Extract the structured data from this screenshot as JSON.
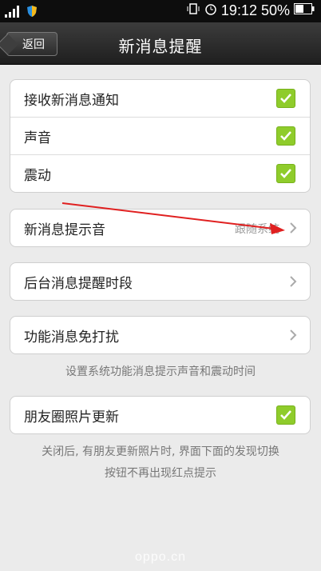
{
  "status_bar": {
    "signal_icon": "signal-icon",
    "shield_icon": "shield-icon",
    "time": "19:12",
    "battery_percent": "50%"
  },
  "header": {
    "back_label": "返回",
    "title": "新消息提醒"
  },
  "group_notifications": {
    "items": [
      {
        "label": "接收新消息通知",
        "checked": true
      },
      {
        "label": "声音",
        "checked": true
      },
      {
        "label": "震动",
        "checked": true
      }
    ]
  },
  "ringtone": {
    "label": "新消息提示音",
    "value": "跟随系统"
  },
  "background_period": {
    "label": "后台消息提醒时段"
  },
  "function_dnd": {
    "label": "功能消息免打扰"
  },
  "function_note": "设置系统功能消息提示声音和震动时间",
  "moments_update": {
    "label": "朋友圈照片更新",
    "checked": true
  },
  "moments_note_line1": "关闭后, 有朋友更新照片时, 界面下面的发现切换",
  "moments_note_line2": "按钮不再出现红点提示",
  "watermark": "oppo.cn",
  "colors": {
    "check_green": "#8fcc2b",
    "annotation_red": "#e02020"
  }
}
